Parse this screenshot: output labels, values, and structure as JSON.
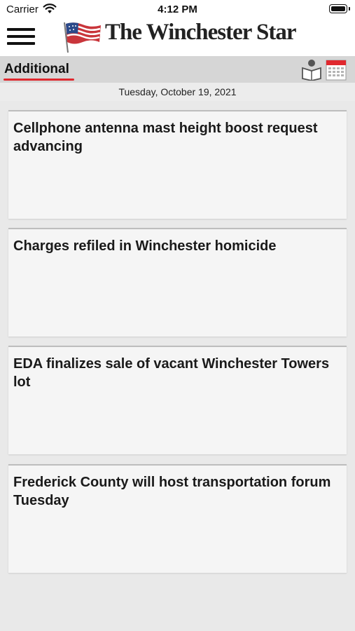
{
  "status_bar": {
    "carrier": "Carrier",
    "time": "4:12 PM"
  },
  "header": {
    "masthead": "The Winchester Star"
  },
  "section": {
    "title": "Additional",
    "accent_color": "#e0282e"
  },
  "date": "Tuesday, October 19, 2021",
  "articles": [
    {
      "headline": "Cellphone antenna mast height boost request advancing"
    },
    {
      "headline": "Charges refiled in Winchester homicide"
    },
    {
      "headline": "EDA finalizes sale of vacant Winchester Towers lot"
    },
    {
      "headline": "Frederick County will host transportation forum Tuesday"
    }
  ]
}
